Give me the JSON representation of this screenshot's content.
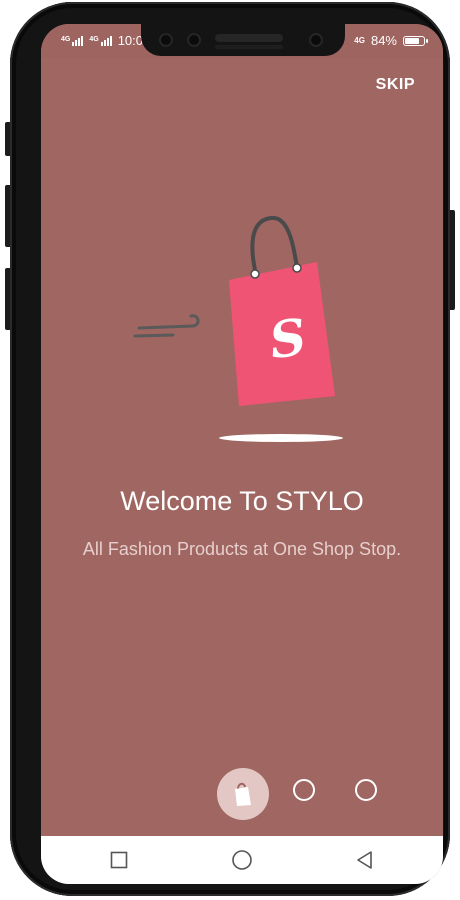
{
  "status_bar": {
    "left_network_1": "4G",
    "left_network_2": "4G",
    "time": "10:0",
    "right_network": "4G",
    "battery_text": "84%",
    "battery_level": 0.84
  },
  "onboarding": {
    "skip_label": "SKIP",
    "title": "Welcome To STYLO",
    "subtitle": "All Fashion Products at One Shop Stop.",
    "bag_letter": "S",
    "total_pages": 3,
    "active_page": 1
  },
  "nav_bar": {
    "icons": [
      "square-icon",
      "circle-icon",
      "back-triangle-icon"
    ]
  },
  "colors": {
    "background": "#a06662",
    "bag": "#f05474",
    "active_indicator": "#e3c7c4",
    "nav_bar": "#ffffff"
  }
}
